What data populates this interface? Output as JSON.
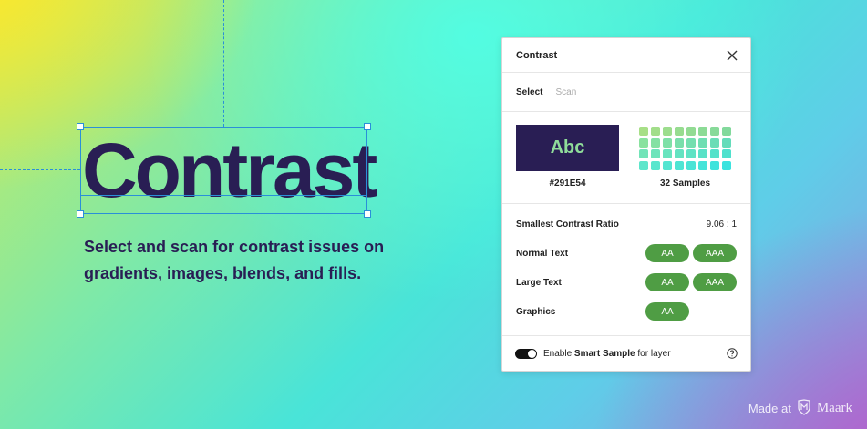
{
  "hero": {
    "word": "Contrast",
    "tagline": "Select and scan for contrast issues on gradients, images, blends, and fills."
  },
  "panel": {
    "title": "Contrast",
    "tabs": [
      {
        "label": "Select",
        "active": true
      },
      {
        "label": "Scan",
        "active": false
      }
    ],
    "swatch": {
      "text": "Abc",
      "color": "#291E54",
      "label": "#291E54"
    },
    "samples": {
      "label": "32 Samples",
      "colors": [
        "#a7df87",
        "#a2de8a",
        "#9cdd8d",
        "#97dc90",
        "#92db93",
        "#8cdb96",
        "#87da99",
        "#82d99c",
        "#89e29f",
        "#84e1a3",
        "#7ee0a7",
        "#79dfab",
        "#74dfaf",
        "#6fdeb2",
        "#6addb6",
        "#64dcba",
        "#72e4b8",
        "#6de4bb",
        "#68e4be",
        "#63e3c1",
        "#5ee3c4",
        "#59e2c7",
        "#54e2ca",
        "#4fe1cd",
        "#5ee6cb",
        "#59e6ce",
        "#54e5d1",
        "#4fe5d3",
        "#4ae4d6",
        "#45e4d9",
        "#40e3dc",
        "#3be3df"
      ]
    },
    "results": {
      "smallest_ratio_label": "Smallest Contrast Ratio",
      "smallest_ratio_value": "9.06 : 1",
      "rows": [
        {
          "label": "Normal Text",
          "badges": [
            "AA",
            "AAA"
          ]
        },
        {
          "label": "Large Text",
          "badges": [
            "AA",
            "AAA"
          ]
        },
        {
          "label": "Graphics",
          "badges": [
            "AA"
          ]
        }
      ],
      "pass_color": "#4f9d44"
    },
    "footer": {
      "prefix": "Enable ",
      "bold": "Smart Sample",
      "suffix": " for layer",
      "toggle_on": true
    }
  },
  "credit": {
    "prefix": "Made at",
    "brand": "Maark"
  }
}
